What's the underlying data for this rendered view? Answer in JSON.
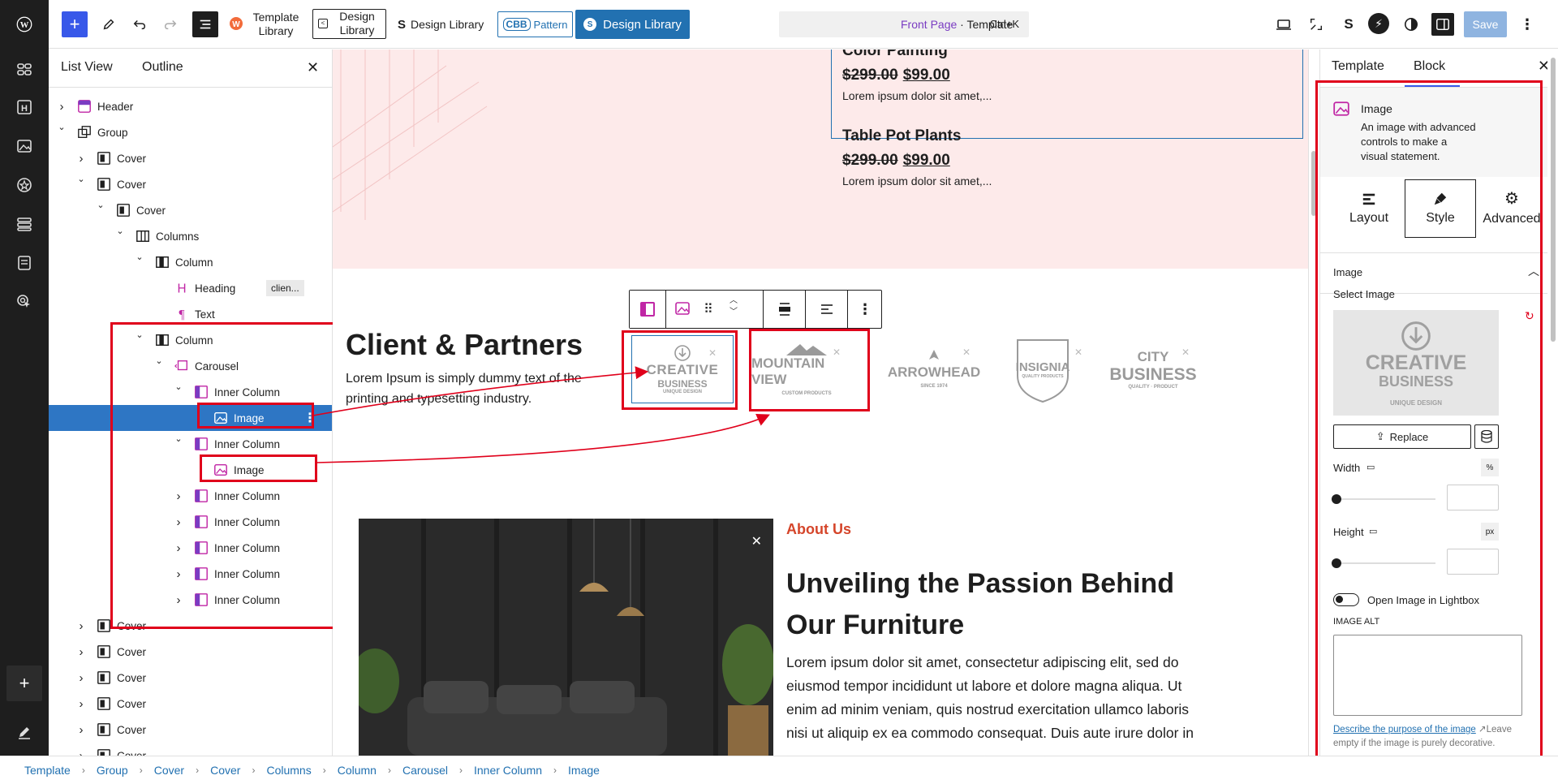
{
  "topbar": {
    "template_library_1": "Template",
    "template_library_2": "Library",
    "design_library_1": "Design",
    "design_library_2": "Library",
    "design_library_plain": "Design Library",
    "cbb_badge": "CBB",
    "pattern_label": "Pattern",
    "design_library_btn": "Design Library",
    "command": {
      "page": "Front Page",
      "sep": " · ",
      "type": "Template",
      "shortcut": "Ctrl+K"
    },
    "save_label": "Save"
  },
  "listview": {
    "tabs": [
      "List View",
      "Outline"
    ],
    "rows": [
      {
        "label": "Header"
      },
      {
        "label": "Group"
      },
      {
        "label": "Cover"
      },
      {
        "label": "Cover"
      },
      {
        "label": "Cover"
      },
      {
        "label": "Columns"
      },
      {
        "label": "Column"
      },
      {
        "label": "Heading",
        "badge": "clien..."
      },
      {
        "label": "Text"
      },
      {
        "label": "Column"
      },
      {
        "label": "Carousel"
      },
      {
        "label": "Inner Column"
      },
      {
        "label": "Image"
      },
      {
        "label": "Inner Column"
      },
      {
        "label": "Image"
      },
      {
        "label": "Inner Column"
      },
      {
        "label": "Inner Column"
      },
      {
        "label": "Inner Column"
      },
      {
        "label": "Inner Column"
      },
      {
        "label": "Inner Column"
      },
      {
        "label": "Cover"
      },
      {
        "label": "Cover"
      },
      {
        "label": "Cover"
      },
      {
        "label": "Cover"
      },
      {
        "label": "Cover"
      },
      {
        "label": "Cover"
      }
    ]
  },
  "canvas": {
    "product_1": {
      "title": "Color Painting",
      "old_price": "$299.00",
      "new_price": "$99.00",
      "desc": "Lorem ipsum dolor sit amet,..."
    },
    "product_2": {
      "title": "Table Pot Plants",
      "old_price": "$299.00",
      "new_price": "$99.00",
      "desc": "Lorem ipsum dolor sit amet,..."
    },
    "clients": {
      "heading": "Client & Partners",
      "text_1": "Lorem Ipsum is simply dummy text of the",
      "text_2": "printing and typesetting industry."
    },
    "logos": [
      {
        "line1": "CREATIVE",
        "line2": "BUSINESS",
        "line3": "UNIQUE DESIGN"
      },
      {
        "line1": "MOUNTAIN VIEW",
        "line2": "",
        "line3": "CUSTOM PRODUCTS"
      },
      {
        "line1": "ARROWHEAD",
        "line2": "",
        "line3": "SINCE 1974"
      },
      {
        "line1": "INSIGNIA",
        "line2": "",
        "line3": "QUALITY PRODUCTS"
      },
      {
        "line1": "CITY",
        "line2": "BUSINESS",
        "line3": "QUALITY · PRODUCT"
      }
    ],
    "about": {
      "kicker": "About Us",
      "title_1": "Unveiling the Passion Behind",
      "title_2": "Our Furniture",
      "body": [
        "Lorem ipsum dolor sit amet, consectetur adipiscing elit, sed do",
        "eiusmod tempor incididunt ut labore et dolore magna aliqua. Ut",
        "enim ad minim veniam, quis nostrud exercitation ullamco laboris",
        "nisi ut aliquip ex ea commodo consequat. Duis aute irure dolor in"
      ]
    }
  },
  "sidebar": {
    "tabs": [
      "Template",
      "Block"
    ],
    "block_name": "Image",
    "block_desc_1": "An image with advanced",
    "block_desc_2": "controls to make a",
    "block_desc_3": "visual statement.",
    "segments": [
      "Layout",
      "Style",
      "Advanced"
    ],
    "section_title": "Image",
    "select_image": "Select Image",
    "preview": {
      "line1": "CREATIVE",
      "line2": "BUSINESS",
      "line3": "UNIQUE DESIGN"
    },
    "replace_label": "Replace",
    "width_label": "Width",
    "width_unit": "%",
    "height_label": "Height",
    "height_unit": "px",
    "lightbox_label": "Open Image in Lightbox",
    "alt_label": "IMAGE ALT",
    "alt_link": "Describe the purpose of the image",
    "alt_help_1": "Leave",
    "alt_help_2": "empty if the image is purely decorative."
  },
  "breadcrumb": [
    "Template",
    "Group",
    "Cover",
    "Cover",
    "Columns",
    "Column",
    "Carousel",
    "Inner Column",
    "Image"
  ],
  "colors": {
    "accent": "#2271b1",
    "wp_blue": "#3858e9",
    "annotation_red": "#e0001b",
    "pink_band": "#fdeaea",
    "about_kicker": "#d5452a"
  }
}
